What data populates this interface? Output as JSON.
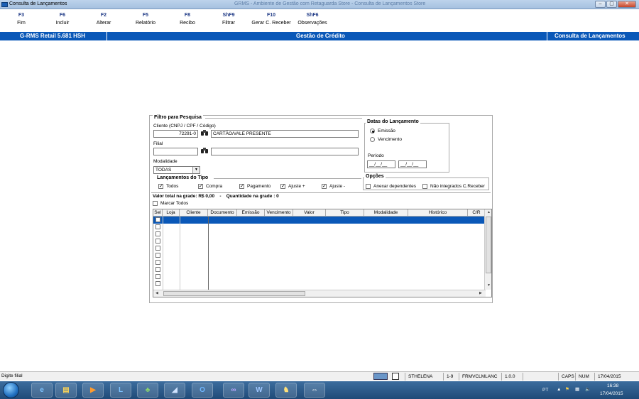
{
  "window": {
    "title": "Consulta de Lançamentos",
    "center_title": "GRMS - Ambiente de Gestão com Retaguarda Store - Consulta de Lançamentos Store"
  },
  "toolbar": [
    {
      "key": "F3",
      "label": "Fim"
    },
    {
      "key": "F6",
      "label": "Incluir"
    },
    {
      "key": "F2",
      "label": "Alterar"
    },
    {
      "key": "F5",
      "label": "Relatório"
    },
    {
      "key": "F8",
      "label": "Recibo"
    },
    {
      "key": "ShF9",
      "label": "Filtrar"
    },
    {
      "key": "F10",
      "label": "Gerar C. Receber"
    },
    {
      "key": "ShF6",
      "label": "Observações"
    }
  ],
  "header": {
    "left": "G-RMS Retail 5.681 HSH",
    "center": "Gestão de Crédito",
    "right": "Consulta de Lançamentos"
  },
  "filter": {
    "legend": "Filtro para Pesquisa",
    "client_label": "Cliente (CNPJ / CPF / Código)",
    "client_code": "72291-0",
    "client_name": "CARTÃO/VALE PRESENTE",
    "filial_label": "Filial",
    "filial_code": "",
    "filial_name": "",
    "modalidade_label": "Modalidade",
    "modalidade_value": "TODAS"
  },
  "dates": {
    "legend": "Datas do Lançamento",
    "emissao": "Emissão",
    "vencimento": "Vencimento",
    "periodo_label": "Período",
    "start": "__/__/__",
    "end": "__/__/__"
  },
  "tipos": {
    "legend": "Lançamentos do Tipo",
    "items": [
      "Todos",
      "Compra",
      "Pagamento",
      "Ajuste +",
      "Ajuste -"
    ]
  },
  "opcoes": {
    "legend": "Opções",
    "anexar": "Anexar dependentes",
    "nao_integrados": "Não integrados C.Receber"
  },
  "summary": {
    "total_label": "Valor total na grade:",
    "total_value": "R$ 0,00",
    "sep": "-",
    "qty_label": "Quantidade na grade :",
    "qty_value": "0",
    "marcar_todos": "Marcar Todos"
  },
  "grid": {
    "columns": [
      "Sel",
      "Loja",
      "Cliente",
      "Documento",
      "Emissão",
      "Vencimento",
      "Valor",
      "Tipo",
      "Modalidade",
      "Histórico",
      "C/R"
    ]
  },
  "statusbar": {
    "text": "Digite filial",
    "user": "STHELENA",
    "range": "1-9",
    "form": "FRMVCLMLANC",
    "version": "1.0.0",
    "caps": "CAPS",
    "num": "NUM",
    "date": "17/04/2015"
  },
  "taskbar": {
    "lang": "PT",
    "time": "16:38",
    "date": "17/04/2015"
  }
}
